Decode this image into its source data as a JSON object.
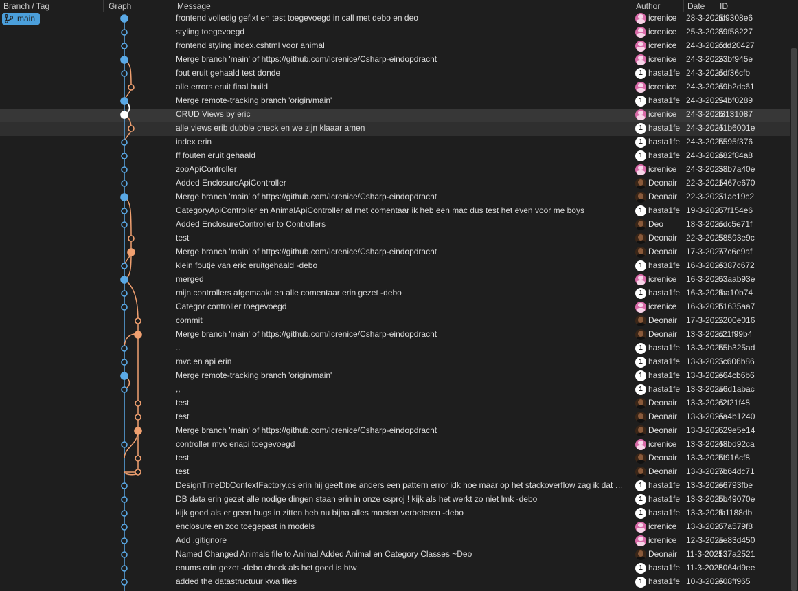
{
  "columns": {
    "branch": "Branch / Tag",
    "graph": "Graph",
    "message": "Message",
    "author": "Author",
    "date": "Date",
    "id": "ID"
  },
  "branch_tag": {
    "label": "main",
    "icon": "branch-icon"
  },
  "colors": {
    "main_lane": "#5aa9e6",
    "side_lane": "#f0a070",
    "selected_node": "#ffffff"
  },
  "commits": [
    {
      "message": "frontend volledig gefixt en test toegevoegd in call met debo en deo",
      "author": "icrenice",
      "avatar": "pink",
      "date": "28-3-2025...",
      "id": "fd9308e6"
    },
    {
      "message": "styling toegevoegd",
      "author": "icrenice",
      "avatar": "pink",
      "date": "25-3-2025...",
      "id": "89f58227"
    },
    {
      "message": "frontend styling index.cshtml voor animal",
      "author": "icrenice",
      "avatar": "pink",
      "date": "24-3-2025...",
      "id": "cdd20427"
    },
    {
      "message": "Merge branch 'main' of https://github.com/Icrenice/Csharp-eindopdracht",
      "author": "icrenice",
      "avatar": "pink",
      "date": "24-3-2025...",
      "id": "23bf945e"
    },
    {
      "message": "fout eruit gehaald test donde",
      "author": "hasta1fe",
      "avatar": "number",
      "date": "24-3-2025...",
      "id": "ddf36cfb"
    },
    {
      "message": "alle errors eruit final build",
      "author": "icrenice",
      "avatar": "pink",
      "date": "24-3-2025...",
      "id": "d9b2dc61"
    },
    {
      "message": "Merge remote-tracking branch 'origin/main'",
      "author": "hasta1fe",
      "avatar": "number",
      "date": "24-3-2025...",
      "id": "94bf0289"
    },
    {
      "message": "CRUD Views by eric",
      "author": "icrenice",
      "avatar": "pink",
      "date": "24-3-2025...",
      "id": "f3131087"
    },
    {
      "message": "alle views erib dubble check en we zijn klaaar amen",
      "author": "hasta1fe",
      "avatar": "number",
      "date": "24-3-2025...",
      "id": "41b6001e"
    },
    {
      "message": "index erin",
      "author": "hasta1fe",
      "avatar": "number",
      "date": "24-3-2025...",
      "id": "b595f376"
    },
    {
      "message": "ff fouten eruit gehaald",
      "author": "hasta1fe",
      "avatar": "number",
      "date": "24-3-2025...",
      "id": "a82f84a8"
    },
    {
      "message": "zooApiController",
      "author": "icrenice",
      "avatar": "pink",
      "date": "24-3-2025...",
      "id": "38b7a40e"
    },
    {
      "message": "Added EnclosureApiController",
      "author": "Deonair",
      "avatar": "dark",
      "date": "22-3-2025...",
      "id": "1467e670"
    },
    {
      "message": "Merge branch 'main' of https://github.com/Icrenice/Csharp-eindopdracht",
      "author": "Deonair",
      "avatar": "dark",
      "date": "22-3-2025...",
      "id": "31ac19c2"
    },
    {
      "message": "CategoryApiController en AnimalApiController af met comentaar ik heb een mac dus test het even voor me boys",
      "author": "hasta1fe",
      "avatar": "number",
      "date": "19-3-2025...",
      "id": "07f154e6"
    },
    {
      "message": "Added EnclosureController to Controllers",
      "author": "Deo",
      "avatar": "dark",
      "date": "18-3-2025...",
      "id": "ddc5e71f"
    },
    {
      "message": "test",
      "author": "Deonair",
      "avatar": "dark",
      "date": "22-3-2025...",
      "id": "58593e9c"
    },
    {
      "message": "Merge branch 'main' of https://github.com/Icrenice/Csharp-eindopdracht",
      "author": "Deonair",
      "avatar": "dark",
      "date": "17-3-2025...",
      "id": "77c6e9af"
    },
    {
      "message": "klein foutje van eric eruitgehaald -debo",
      "author": "hasta1fe",
      "avatar": "number",
      "date": "16-3-2025...",
      "id": "e387c672"
    },
    {
      "message": "merged",
      "author": "icrenice",
      "avatar": "pink",
      "date": "16-3-2025...",
      "id": "03aab93e"
    },
    {
      "message": "mijn controllers afgemaakt en alle comentaar erin gezet -debo",
      "author": "hasta1fe",
      "avatar": "number",
      "date": "16-3-2025...",
      "id": "fba10b74"
    },
    {
      "message": "Categor controller toegevoegd",
      "author": "icrenice",
      "avatar": "pink",
      "date": "16-3-2025...",
      "id": "b1635aa7"
    },
    {
      "message": "commit",
      "author": "Deonair",
      "avatar": "dark",
      "date": "17-3-2025...",
      "id": "2200e016"
    },
    {
      "message": "Merge branch 'main' of https://github.com/Icrenice/Csharp-eindopdracht",
      "author": "Deonair",
      "avatar": "dark",
      "date": "13-3-2025...",
      "id": "c21f99b4"
    },
    {
      "message": "..",
      "author": "hasta1fe",
      "avatar": "number",
      "date": "13-3-2025...",
      "id": "b5b325ad"
    },
    {
      "message": "mvc en api erin",
      "author": "hasta1fe",
      "avatar": "number",
      "date": "13-3-2025...",
      "id": "3c606b86"
    },
    {
      "message": "Merge remote-tracking branch 'origin/main'",
      "author": "hasta1fe",
      "avatar": "number",
      "date": "13-3-2025...",
      "id": "e64cb6b6"
    },
    {
      "message": ",,",
      "author": "hasta1fe",
      "avatar": "number",
      "date": "13-3-2025...",
      "id": "a6d1abac"
    },
    {
      "message": "test",
      "author": "Deonair",
      "avatar": "dark",
      "date": "13-3-2025...",
      "id": "c2f21f48"
    },
    {
      "message": "test",
      "author": "Deonair",
      "avatar": "dark",
      "date": "13-3-2025...",
      "id": "ea4b1240"
    },
    {
      "message": "Merge branch 'main' of https://github.com/Icrenice/Csharp-eindopdracht",
      "author": "Deonair",
      "avatar": "dark",
      "date": "13-3-2025...",
      "id": "629e5e14"
    },
    {
      "message": "controller mvc enapi toegevoegd",
      "author": "icrenice",
      "avatar": "pink",
      "date": "13-3-2025...",
      "id": "48bd92ca"
    },
    {
      "message": "test",
      "author": "Deonair",
      "avatar": "dark",
      "date": "13-3-2025...",
      "id": "bf916cf8"
    },
    {
      "message": "test",
      "author": "Deonair",
      "avatar": "dark",
      "date": "13-3-2025...",
      "id": "7b64dc71"
    },
    {
      "message": "DesignTimeDbContextFactory.cs erin hij geeft me anders een pattern error idk hoe maar op het stackoverflow zag ik dat je...",
      "author": "hasta1fe",
      "avatar": "number",
      "date": "13-3-2025...",
      "id": "e6793fbe"
    },
    {
      "message": "DB data erin gezet alle nodige dingen staan erin in onze csproj ! kijk als het werkt zo niet lmk -debo",
      "author": "hasta1fe",
      "avatar": "number",
      "date": "13-3-2025...",
      "id": "bb49070e"
    },
    {
      "message": "kijk goed als er geen bugs in zitten heb nu bijna alles moeten verbeteren -debo",
      "author": "hasta1fe",
      "avatar": "number",
      "date": "13-3-2025...",
      "id": "fb1188db"
    },
    {
      "message": "enclosure en zoo toegepast in models",
      "author": "icrenice",
      "avatar": "pink",
      "date": "13-3-2025...",
      "id": "07a579f8"
    },
    {
      "message": "Add .gitignore",
      "author": "icrenice",
      "avatar": "pink",
      "date": "12-3-2025...",
      "id": "ae83d450"
    },
    {
      "message": "Named Changed Animals file to Animal Added Animal en Category Classes ~Deo",
      "author": "Deonair",
      "avatar": "dark",
      "date": "11-3-2025...",
      "id": "137a2521"
    },
    {
      "message": "enums erin gezet -debo check als het goed is btw",
      "author": "hasta1fe",
      "avatar": "number",
      "date": "11-3-2025...",
      "id": "8064d9ee"
    },
    {
      "message": "added the datastructuur kwa files",
      "author": "hasta1fe",
      "avatar": "number",
      "date": "10-3-2025...",
      "id": "e08ff965"
    }
  ],
  "avatar_number": "1"
}
